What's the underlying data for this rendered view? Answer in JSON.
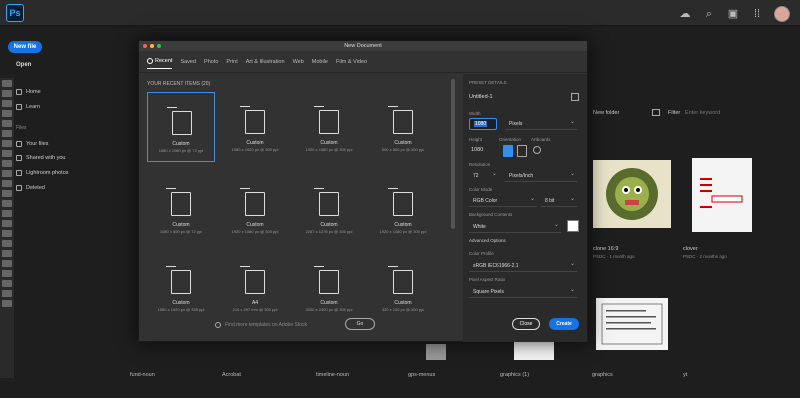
{
  "app": {
    "logo": "Ps"
  },
  "home": {
    "new_file": "New file",
    "open": "Open",
    "nav": [
      "Home",
      "Learn"
    ],
    "files_section": "Files",
    "files": [
      "Your files",
      "Shared with you",
      "Lightroom photos",
      "Deleted"
    ]
  },
  "background": {
    "new_folder": "New folder",
    "filter_label": "Filter",
    "filter_placeholder": "Enter keyword",
    "cards": [
      {
        "name": "clone 16:9",
        "meta": "PSDC · 1 month ago"
      },
      {
        "name": "clover",
        "meta": "PSDC · 2 months ago"
      }
    ],
    "bottom_names": [
      "fund-noun",
      "Acrobat",
      "timeline-noun",
      "gps-menus",
      "graphics (1)",
      "graphics",
      "yt"
    ]
  },
  "dialog": {
    "title": "New Document",
    "tabs": [
      "Recent",
      "Saved",
      "Photo",
      "Print",
      "Art & Illustration",
      "Web",
      "Mobile",
      "Film & Video"
    ],
    "recent_header": "YOUR RECENT ITEMS (20)",
    "presets": [
      {
        "name": "Custom",
        "dims": "1080 x 1080 px @ 72 ppi"
      },
      {
        "name": "Custom",
        "dims": "1080 x 1920 px @ 300 ppi"
      },
      {
        "name": "Custom",
        "dims": "1920 x 1080 px @ 300 ppi"
      },
      {
        "name": "Custom",
        "dims": "500 x 500 px @ 300 ppi"
      },
      {
        "name": "Custom",
        "dims": "1080 x 500 px @ 72 ppi"
      },
      {
        "name": "Custom",
        "dims": "1920 x 1080 px @ 300 ppi"
      },
      {
        "name": "Custom",
        "dims": "2267 x 1276 px @ 300 ppi"
      },
      {
        "name": "Custom",
        "dims": "1920 x 1080 px @ 300 ppi"
      },
      {
        "name": "Custom",
        "dims": "1080 x 1920 px @ 335 ppi"
      },
      {
        "name": "A4",
        "dims": "210 x 297 mm @ 300 ppi"
      },
      {
        "name": "Custom",
        "dims": "3000 x 2400 px @ 300 ppi"
      },
      {
        "name": "Custom",
        "dims": "320 x 100 px @ 300 ppi"
      }
    ],
    "search_placeholder": "Find more templates on Adobe Stock",
    "go": "Go",
    "details": {
      "header": "PRESET DETAILS",
      "doc_name": "Untitled-1",
      "width_label": "Width",
      "width_value": "1080",
      "width_unit": "Pixels",
      "height_label": "Height",
      "height_value": "1080",
      "orientation_label": "Orientation",
      "artboards_label": "Artboards",
      "resolution_label": "Resolution",
      "resolution_value": "72",
      "resolution_unit": "Pixels/Inch",
      "color_mode_label": "Color Mode",
      "color_mode_value": "RGB Color",
      "bit_depth": "8 bit",
      "background_label": "Background Contents",
      "background_value": "White",
      "advanced": "Advanced Options",
      "color_profile_label": "Color Profile",
      "color_profile_value": "sRGB IEC61966-2.1",
      "pixel_ratio_label": "Pixel Aspect Ratio",
      "pixel_ratio_value": "Square Pixels"
    },
    "close": "Close",
    "create": "Create"
  },
  "colors": {
    "accent": "#1473e6",
    "selection": "#378ef0"
  }
}
